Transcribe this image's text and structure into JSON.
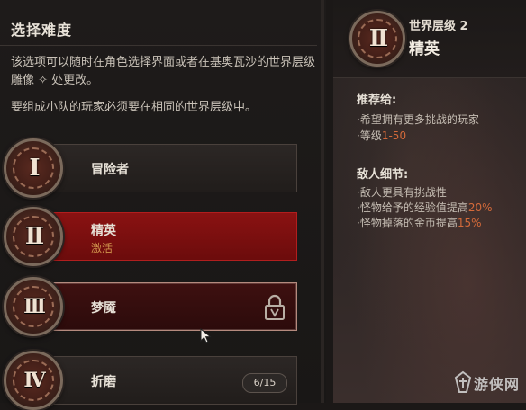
{
  "left_panel": {
    "title": "选择难度",
    "description_1": "该选项可以随时在角色选择界面或者在基奥瓦沙的世界层级雕像 ✧ 处更改。",
    "description_2": "要组成小队的玩家必须要在相同的世界层级中。"
  },
  "difficulties": [
    {
      "numeral": "I",
      "label": "冒险者",
      "sub": "",
      "state": "normal"
    },
    {
      "numeral": "II",
      "label": "精英",
      "sub": "激活",
      "state": "active"
    },
    {
      "numeral": "III",
      "label": "梦魇",
      "sub": "",
      "state": "locked-hover"
    },
    {
      "numeral": "IV",
      "label": "折磨",
      "sub": "",
      "state": "progress",
      "progress": "6/15"
    }
  ],
  "right_panel": {
    "numeral": "II",
    "level_label": "世界层级 2",
    "name": "精英",
    "recommended_title": "推荐给:",
    "recommended": [
      {
        "text": "希望拥有更多挑战的玩家",
        "highlight": ""
      },
      {
        "text": "等级",
        "highlight": "1-50"
      }
    ],
    "enemy_title": "敌人细节:",
    "enemy_details": [
      {
        "text": "敌人更具有挑战性",
        "highlight": ""
      },
      {
        "text": "怪物给予的经验值提高",
        "highlight": "20%"
      },
      {
        "text": "怪物掉落的金币提高",
        "highlight": "15%"
      }
    ],
    "bullet_char": "·"
  },
  "watermark": {
    "text": "游侠网"
  },
  "colors": {
    "active_red": "#8a1212",
    "highlight_orange": "#d46a3a",
    "active_sub": "#d0954d"
  }
}
